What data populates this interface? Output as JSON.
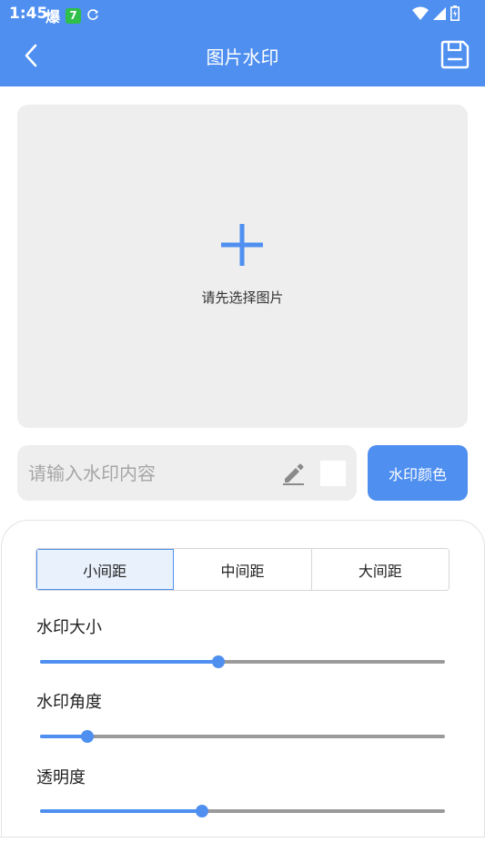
{
  "status_bar": {
    "time": "1:45",
    "left_icons": [
      "explode-app-icon",
      "app-7-icon",
      "sync-icon"
    ],
    "right_icons": [
      "wifi-icon",
      "signal-icon",
      "battery-icon"
    ],
    "badge_text": "7"
  },
  "header": {
    "title": "图片水印",
    "back_icon": "chevron-left-icon",
    "save_icon": "save-icon"
  },
  "image_picker": {
    "icon": "plus-icon",
    "hint": "请先选择图片"
  },
  "watermark_input": {
    "value": "",
    "placeholder": "请输入水印内容",
    "edit_icon": "pencil-icon",
    "selected_color": "#ffffff"
  },
  "color_button": {
    "label": "水印颜色"
  },
  "spacing": {
    "options": [
      "小间距",
      "中间距",
      "大间距"
    ],
    "selected": "小间距"
  },
  "sliders": [
    {
      "label": "水印大小",
      "value": 0.44
    },
    {
      "label": "水印角度",
      "value": 0.117
    },
    {
      "label": "透明度",
      "value": 0.4
    }
  ],
  "colors": {
    "accent": "#4f8ff0",
    "panel_bg": "#eeeeee",
    "track": "#9a9a9a"
  }
}
